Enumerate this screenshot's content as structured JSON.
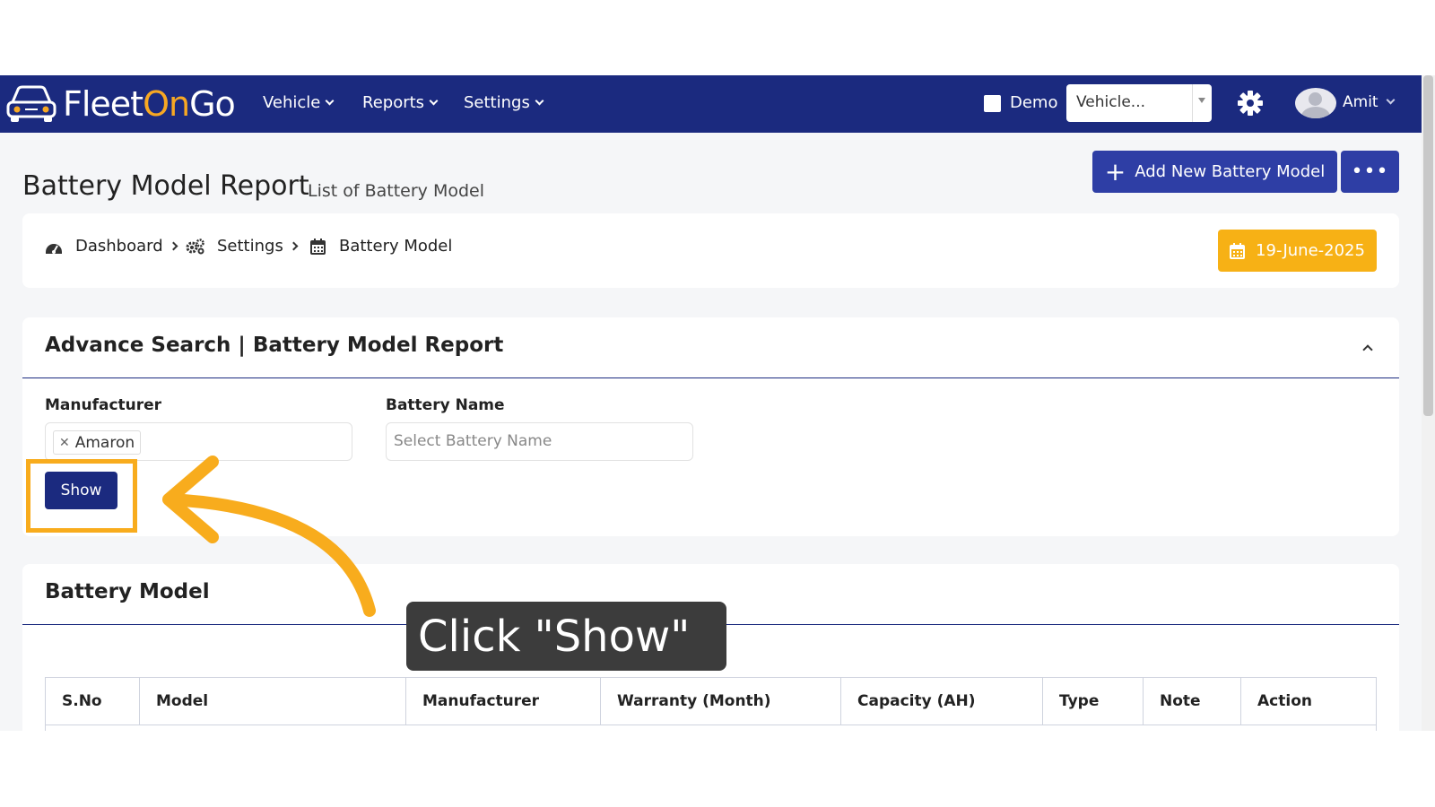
{
  "navbar": {
    "brand": {
      "part1": "Fleet",
      "part2": "On",
      "part3": "Go"
    },
    "menu": [
      "Vehicle",
      "Reports",
      "Settings"
    ],
    "demo_label": "Demo",
    "vehicle_select": "Vehicle...",
    "user_name": "Amit",
    "colors": {
      "bg": "#1b2a7f",
      "accent": "#f7a823"
    }
  },
  "page": {
    "title": "Battery Model Report",
    "subtitle": "List of Battery Model",
    "add_button": "Add New Battery Model",
    "more_button": "•••"
  },
  "breadcrumb": {
    "items": [
      "Dashboard",
      "Settings",
      "Battery Model"
    ],
    "date": "19-June-2025"
  },
  "search": {
    "title": "Advance Search | Battery Model Report",
    "manufacturer_label": "Manufacturer",
    "manufacturer_tag": "Amaron",
    "battery_label": "Battery Name",
    "battery_placeholder": "Select Battery Name",
    "show_button": "Show"
  },
  "table": {
    "title": "Battery Model",
    "columns": [
      "S.No",
      "Model",
      "Manufacturer",
      "Warranty (Month)",
      "Capacity (AH)",
      "Type",
      "Note",
      "Action"
    ]
  },
  "tutorial": {
    "caption": "Click \"Show\"",
    "highlight_color": "#f8ac1d"
  }
}
